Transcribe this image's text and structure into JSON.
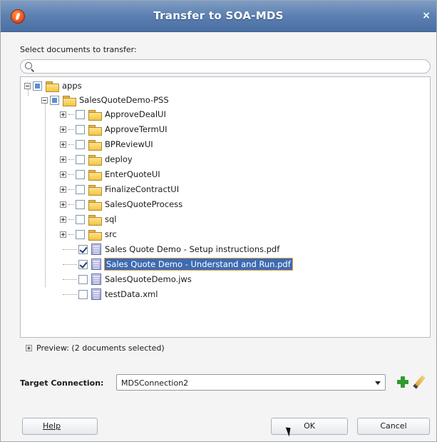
{
  "window": {
    "title": "Transfer to SOA-MDS",
    "close_glyph": "×"
  },
  "prompt": "Select documents to transfer:",
  "search": {
    "value": "",
    "placeholder": ""
  },
  "tree": {
    "root": {
      "label": "apps",
      "state": "partial"
    },
    "project": {
      "label": "SalesQuoteDemo-PSS",
      "state": "partial"
    },
    "children": [
      {
        "label": "ApproveDealUI",
        "type": "folder",
        "checked": false
      },
      {
        "label": "ApproveTermUI",
        "type": "folder",
        "checked": false
      },
      {
        "label": "BPReviewUI",
        "type": "folder",
        "checked": false
      },
      {
        "label": "deploy",
        "type": "folder",
        "checked": false
      },
      {
        "label": "EnterQuoteUI",
        "type": "folder",
        "checked": false
      },
      {
        "label": "FinalizeContractUI",
        "type": "folder",
        "checked": false
      },
      {
        "label": "SalesQuoteProcess",
        "type": "folder",
        "checked": false
      },
      {
        "label": "sql",
        "type": "folder",
        "checked": false
      },
      {
        "label": "src",
        "type": "folder",
        "checked": false
      },
      {
        "label": "Sales Quote Demo - Setup instructions.pdf",
        "type": "file",
        "checked": true
      },
      {
        "label": "Sales Quote Demo - Understand and Run.pdf",
        "type": "file",
        "checked": true,
        "selected": true
      },
      {
        "label": "SalesQuoteDemo.jws",
        "type": "file",
        "checked": false
      },
      {
        "label": "testData.xml",
        "type": "file",
        "checked": false
      }
    ]
  },
  "preview": {
    "label": "Preview: (2 documents selected)"
  },
  "target_connection": {
    "label": "Target Connection:",
    "value": "MDSConnection2"
  },
  "buttons": {
    "help": "Help",
    "ok": "OK",
    "cancel": "Cancel"
  },
  "icons": [
    "app-icon",
    "close-icon",
    "search-icon",
    "folder-icon",
    "document-icon",
    "add-icon",
    "edit-icon"
  ],
  "colors": {
    "titlebar": "#5b7fb0",
    "selection": "#3d6bb3",
    "selection_outline": "#e8a33a"
  }
}
